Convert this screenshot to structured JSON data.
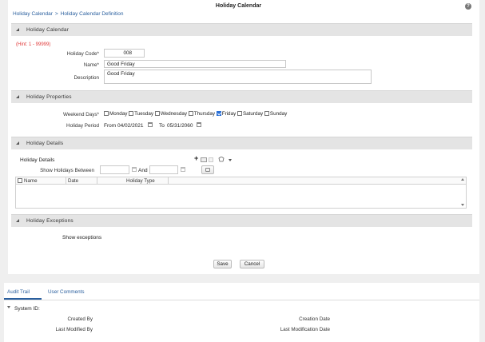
{
  "page": {
    "title": "Holiday Calendar",
    "breadcrumb": [
      "Holiday Calendar",
      "Holiday Calendar Definition"
    ],
    "help_icon": "?"
  },
  "sections": {
    "holiday_calendar": "Holiday Calendar",
    "holiday_properties": "Holiday Properties",
    "holiday_details": "Holiday Details",
    "holiday_exceptions": "Holiday Exceptions"
  },
  "calendar_form": {
    "hint": "(Hint: 1 - 99999)",
    "holiday_code_label": "Holiday Code*",
    "holiday_code_value": "008",
    "name_label": "Name*",
    "name_value": "Good Friday",
    "description_label": "Description",
    "description_value": "Good Friday"
  },
  "properties": {
    "weekend_days_label": "Weekend Days*",
    "days": [
      {
        "label": "Monday",
        "checked": false
      },
      {
        "label": "Tuesday",
        "checked": false
      },
      {
        "label": "Wednesday",
        "checked": false
      },
      {
        "label": "Thursday",
        "checked": false
      },
      {
        "label": "Friday",
        "checked": true
      },
      {
        "label": "Saturday",
        "checked": false
      },
      {
        "label": "Sunday",
        "checked": false
      }
    ],
    "holiday_period_label": "Holiday Period",
    "from_label": "From",
    "from_value": "04/02/2021",
    "to_label": "To",
    "to_value": "05/31/2060"
  },
  "details": {
    "subtitle": "Holiday Details",
    "show_between_label": "Show Holidays Between",
    "and_label": "And",
    "from_value": "",
    "to_value": "",
    "columns": [
      "Name",
      "Date",
      "Holiday Type"
    ]
  },
  "exceptions": {
    "show_exceptions": "Show exceptions"
  },
  "buttons": {
    "save": "Save",
    "cancel": "Cancel"
  },
  "bottom": {
    "tabs": [
      "Audit Trail",
      "User Comments"
    ],
    "active_tab": "Audit Trail",
    "system_id_label": "System ID:",
    "created_by": "Created By",
    "creation_date": "Creation Date",
    "last_modified_by": "Last Modified By",
    "last_modification_date": "Last Modification Date"
  }
}
